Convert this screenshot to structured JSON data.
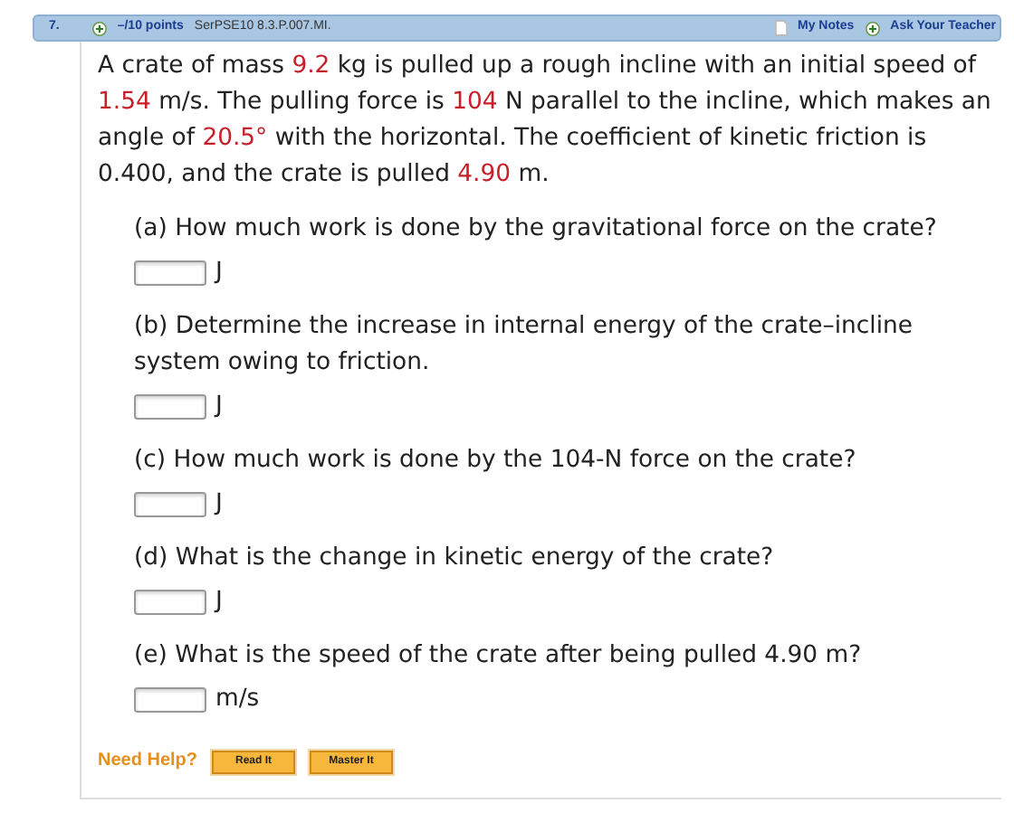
{
  "header": {
    "number": "7.",
    "points": "–/10 points",
    "code": "SerPSE10 8.3.P.007.MI.",
    "my_notes": "My Notes",
    "ask_teacher": "Ask Your Teacher"
  },
  "problem": [
    {
      "text": "A crate of mass ",
      "given": false
    },
    {
      "text": "9.2",
      "given": true
    },
    {
      "text": " kg is pulled up a rough incline with an initial speed of ",
      "given": false
    },
    {
      "text": "1.54",
      "given": true
    },
    {
      "text": " m/s. The pulling force is ",
      "given": false
    },
    {
      "text": "104",
      "given": true
    },
    {
      "text": " N parallel to the incline, which makes an angle of ",
      "given": false
    },
    {
      "text": "20.5°",
      "given": true
    },
    {
      "text": " with the horizontal. The coefficient of kinetic friction is 0.400, and the crate is pulled ",
      "given": false
    },
    {
      "text": "4.90",
      "given": true
    },
    {
      "text": " m.",
      "given": false
    }
  ],
  "parts": [
    {
      "question": "(a) How much work is done by the gravitational force on the crate?",
      "unit": "J"
    },
    {
      "question": "(b) Determine the increase in internal energy of the crate–incline system owing to friction.",
      "unit": "J"
    },
    {
      "question": "(c) How much work is done by the 104-N force on the crate?",
      "unit": "J"
    },
    {
      "question": "(d) What is the change in kinetic energy of the crate?",
      "unit": "J"
    },
    {
      "question": "(e) What is the speed of the crate after being pulled 4.90 m?",
      "unit": "m/s"
    }
  ],
  "help": {
    "label": "Need Help?",
    "buttons": [
      "Read It",
      "Master It"
    ]
  }
}
